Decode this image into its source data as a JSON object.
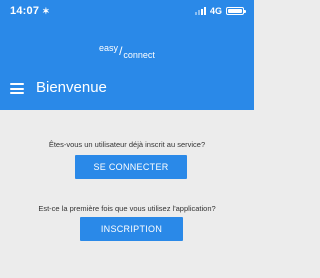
{
  "status_bar": {
    "time": "14:07",
    "location_glyph": "✶",
    "network": "4G"
  },
  "header": {
    "logo": {
      "top": "easy",
      "slash": "/",
      "bottom": "connect"
    },
    "title": "Bienvenue",
    "menu_icon": "hamburger-menu-icon"
  },
  "main": {
    "login_prompt": "Êtes-vous un utilisateur déjà inscrit au service?",
    "login_button": "SE CONNECTER",
    "register_prompt": "Est-ce la première fois que vous utilisez l'application?",
    "register_button": "INSCRIPTION"
  },
  "colors": {
    "primary": "#2a89e8",
    "background": "#ececec"
  }
}
